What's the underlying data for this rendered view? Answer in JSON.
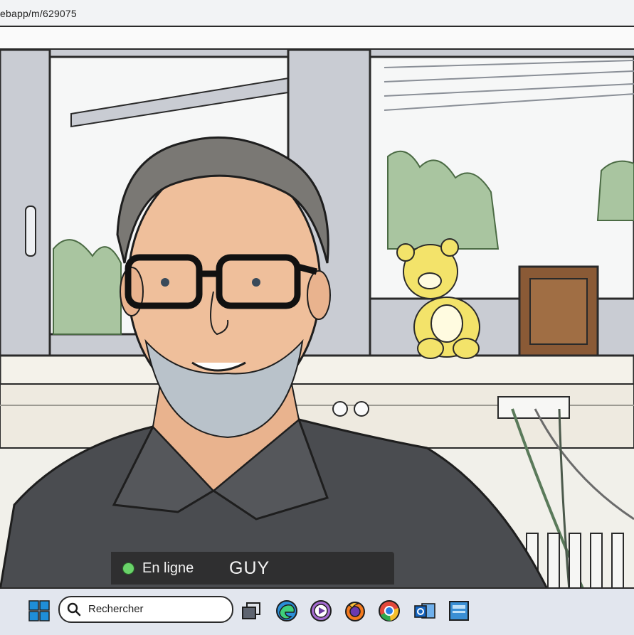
{
  "browser": {
    "url": "ebapp/m/629075"
  },
  "call": {
    "status_text": "En ligne",
    "status_color": "#6ad36a",
    "caller_name": "GUY"
  },
  "taskbar": {
    "search_placeholder": "Rechercher",
    "icons": [
      "windows-start-icon",
      "task-view-icon",
      "edge-icon",
      "media-player-icon",
      "firefox-icon",
      "chrome-icon",
      "outlook-icon",
      "store-app-icon"
    ]
  }
}
